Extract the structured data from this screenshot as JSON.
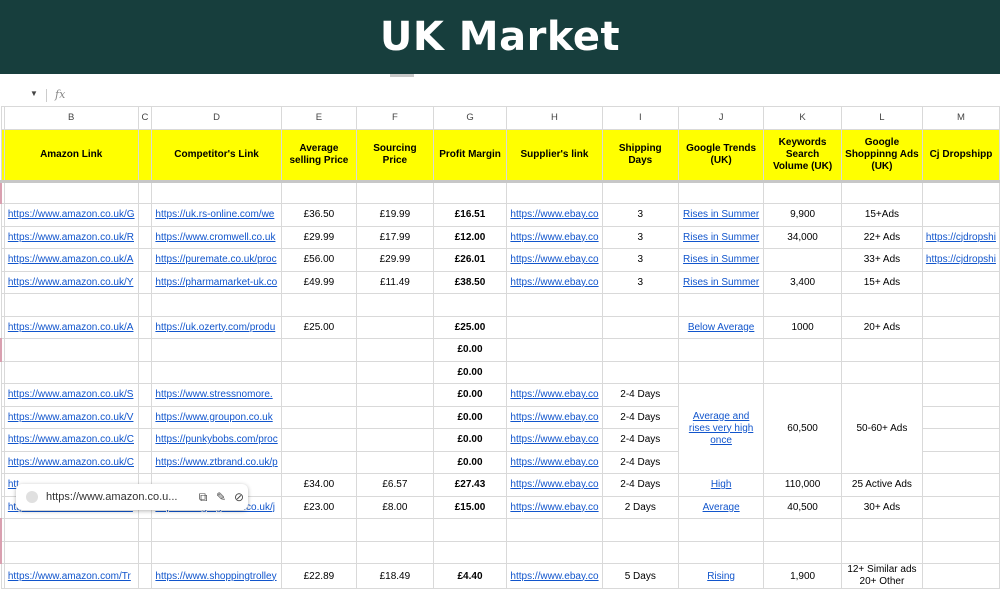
{
  "banner": {
    "title": "UK Market"
  },
  "formula_bar": {
    "fx": "fx"
  },
  "columns": [
    "B",
    "C",
    "D",
    "E",
    "F",
    "G",
    "H",
    "I",
    "J",
    "K",
    "L",
    "M"
  ],
  "headers": [
    "Amazon Link",
    "",
    "Competitor's Link",
    "Average selling Price",
    "Sourcing Price",
    "Profit Margin",
    "Supplier's link",
    "Shipping Days",
    "Google Trends (UK)",
    "Keywords Search Volume (UK)",
    "Google Shoppinng Ads (UK)",
    "Cj Dropshipp"
  ],
  "rows": [
    {
      "amazon": "",
      "comp": "",
      "avg": "",
      "src": "",
      "profit": "",
      "supp": "",
      "ship": "",
      "trend": "",
      "kw": "",
      "ads": "",
      "cj": ""
    },
    {
      "amazon": "https://www.amazon.co.uk/G",
      "comp": "https://uk.rs-online.com/we",
      "avg": "£36.50",
      "src": "£19.99",
      "profit": "£16.51",
      "supp": "https://www.ebay.co",
      "ship": "3",
      "trend": "Rises in Summer",
      "kw": "9,900",
      "ads": "15+Ads",
      "cj": ""
    },
    {
      "amazon": "https://www.amazon.co.uk/R",
      "comp": "https://www.cromwell.co.uk",
      "avg": "£29.99",
      "src": "£17.99",
      "profit": "£12.00",
      "supp": "https://www.ebay.co",
      "ship": "3",
      "trend": "Rises in Summer",
      "kw": "34,000",
      "ads": "22+ Ads",
      "cj": "https://cjdropshi"
    },
    {
      "amazon": "https://www.amazon.co.uk/A",
      "comp": "https://puremate.co.uk/proc",
      "avg": "£56.00",
      "src": "£29.99",
      "profit": "£26.01",
      "supp": "https://www.ebay.co",
      "ship": "3",
      "trend": "Rises in Summer",
      "kw": "",
      "ads": "33+ Ads",
      "cj": "https://cjdropshi"
    },
    {
      "amazon": "https://www.amazon.co.uk/Y",
      "comp": "https://pharmamarket-uk.co",
      "avg": "£49.99",
      "src": "£11.49",
      "profit": "£38.50",
      "supp": "https://www.ebay.co",
      "ship": "3",
      "trend": "Rises in Summer",
      "kw": "3,400",
      "ads": "15+ Ads",
      "cj": ""
    },
    {
      "amazon": "",
      "comp": "",
      "avg": "",
      "src": "",
      "profit": "",
      "supp": "",
      "ship": "",
      "trend": "",
      "kw": "",
      "ads": "",
      "cj": ""
    },
    {
      "amazon": "https://www.amazon.co.uk/A",
      "comp": "https://uk.ozerty.com/produ",
      "avg": "£25.00",
      "src": "",
      "profit": "£25.00",
      "supp": "",
      "ship": "",
      "trend": "Below Average",
      "kw": "1000",
      "ads": "20+ Ads",
      "cj": ""
    },
    {
      "amazon": "",
      "comp": "",
      "avg": "",
      "src": "",
      "profit": "£0.00",
      "supp": "",
      "ship": "",
      "trend": "",
      "kw": "",
      "ads": "",
      "cj": ""
    },
    {
      "amazon": "",
      "comp": "",
      "avg": "",
      "src": "",
      "profit": "£0.00",
      "supp": "",
      "ship": "",
      "trend": "",
      "kw": "",
      "ads": "",
      "cj": ""
    },
    {
      "amazon": "https://www.amazon.co.uk/S",
      "comp": "https://www.stressnomore.",
      "avg": "",
      "src": "",
      "profit": "£0.00",
      "supp": "https://www.ebay.co",
      "ship": "2-4 Days",
      "trend": "",
      "kw": "",
      "ads": "",
      "cj": ""
    },
    {
      "amazon": "https://www.amazon.co.uk/V",
      "comp": "https://www.groupon.co.uk",
      "avg": "",
      "src": "",
      "profit": "£0.00",
      "supp": "https://www.ebay.co",
      "ship": "2-4 Days",
      "trend": "",
      "kw": "",
      "ads": "",
      "cj": ""
    },
    {
      "amazon": "https://www.amazon.co.uk/C",
      "comp": "https://punkybobs.com/proc",
      "avg": "",
      "src": "",
      "profit": "£0.00",
      "supp": "https://www.ebay.co",
      "ship": "2-4 Days",
      "trend": "",
      "kw": "",
      "ads": "",
      "cj": ""
    },
    {
      "amazon": "https://www.amazon.co.uk/C",
      "comp": "https://www.ztbrand.co.uk/p",
      "avg": "",
      "src": "",
      "profit": "£0.00",
      "supp": "https://www.ebay.co",
      "ship": "2-4 Days",
      "trend": "",
      "kw": "",
      "ads": "",
      "cj": ""
    },
    {
      "amazon": "htt",
      "comp": "",
      "avg": "£34.00",
      "src": "£6.57",
      "profit": "£27.43",
      "supp": "https://www.ebay.co",
      "ship": "2-4 Days",
      "trend": "High",
      "kw": "110,000",
      "ads": "25 Active Ads",
      "cj": ""
    },
    {
      "amazon": "https://www.amazon.co.uk/T",
      "comp": "https://feelgorgeous.co.uk/j",
      "avg": "£23.00",
      "src": "£8.00",
      "profit": "£15.00",
      "supp": "https://www.ebay.co",
      "ship": "2 Days",
      "trend": "Average",
      "kw": "40,500",
      "ads": "30+ Ads",
      "cj": ""
    },
    {
      "amazon": "",
      "comp": "",
      "avg": "",
      "src": "",
      "profit": "",
      "supp": "",
      "ship": "",
      "trend": "",
      "kw": "",
      "ads": "",
      "cj": ""
    },
    {
      "amazon": "",
      "comp": "",
      "avg": "",
      "src": "",
      "profit": "",
      "supp": "",
      "ship": "",
      "trend": "",
      "kw": "",
      "ads": "",
      "cj": ""
    },
    {
      "amazon": "https://www.amazon.com/Tr",
      "comp": "https://www.shoppingtrolley",
      "avg": "£22.89",
      "src": "£18.49",
      "profit": "£4.40",
      "supp": "https://www.ebay.co",
      "ship": "5 Days",
      "trend": "Rising",
      "kw": "1,900",
      "ads": "12+ Similar ads 20+ Other",
      "cj": ""
    }
  ],
  "merged": {
    "trend": "Average and rises very high once",
    "kw": "60,500",
    "ads": "50-60+ Ads"
  },
  "link_popup": {
    "url": "https://www.amazon.co.u..."
  },
  "colors": {
    "banner": "#173e3d",
    "header_fill": "#ffff00",
    "link": "#1155cc"
  }
}
